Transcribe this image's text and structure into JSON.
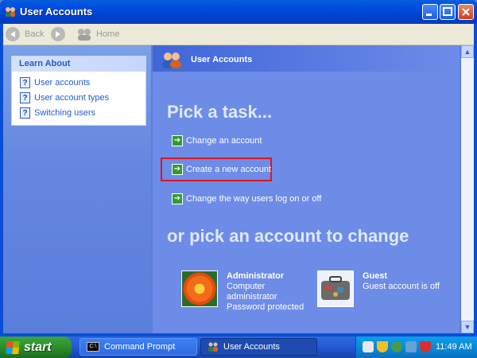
{
  "window": {
    "title": "User Accounts"
  },
  "toolbar": {
    "back_label": "Back",
    "home_label": "Home"
  },
  "left_pane": {
    "learn_about": {
      "heading": "Learn About",
      "items": [
        {
          "label": "User accounts"
        },
        {
          "label": "User account types"
        },
        {
          "label": "Switching users"
        }
      ]
    }
  },
  "main": {
    "header_title": "User Accounts",
    "pick_task_heading": "Pick a task...",
    "tasks": [
      {
        "label": "Change an account"
      },
      {
        "label": "Create a new account"
      },
      {
        "label": "Change the way users log on or off"
      }
    ],
    "pick_account_heading": "or pick an account to change",
    "accounts": [
      {
        "name": "Administrator",
        "details": [
          "Computer",
          "administrator",
          "Password protected"
        ]
      },
      {
        "name": "Guest",
        "details": [
          "Guest account is off"
        ]
      }
    ]
  },
  "taskbar": {
    "start_label": "start",
    "buttons": [
      {
        "label": "Command Prompt",
        "icon_text": "C:\\"
      },
      {
        "label": "User Accounts"
      }
    ],
    "clock": "11:49 AM"
  },
  "icons": {
    "title": "user-accounts-icon",
    "back": "back-arrow-icon",
    "forward": "forward-arrow-icon",
    "home": "home-icon",
    "help": "help-icon",
    "task": "green-arrow-icon"
  },
  "colors": {
    "highlight": "#e0141c",
    "link": "#215dc6",
    "pane": "#6d8ce8",
    "taskbar": "#245edb",
    "start": "#2c8f2c"
  }
}
